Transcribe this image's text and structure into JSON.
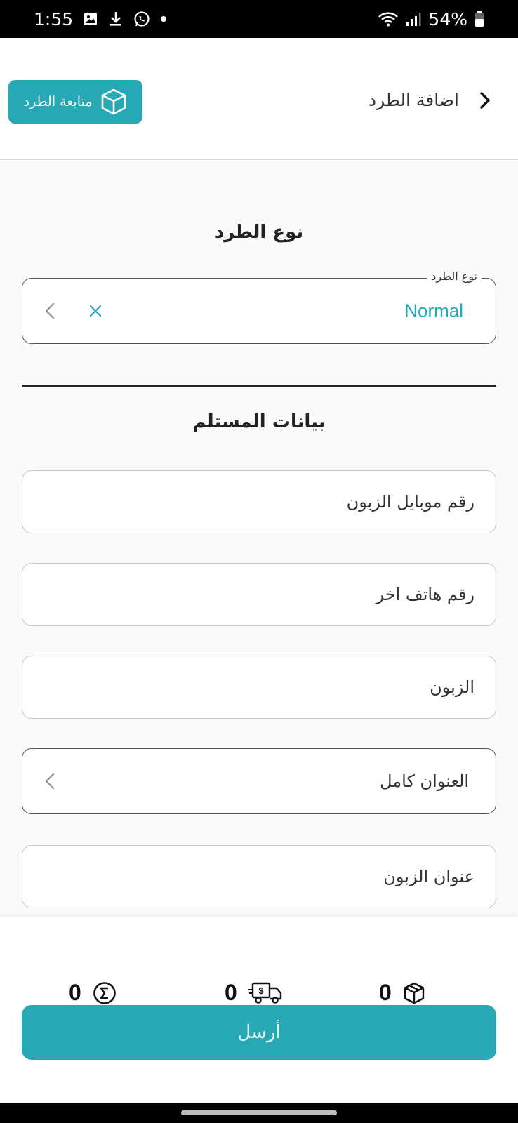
{
  "status_bar": {
    "time": "1:55",
    "battery": "54%",
    "icons": [
      "gallery-icon",
      "download-icon",
      "whatsapp-icon",
      "dot-icon",
      "wifi-icon",
      "signal-icon",
      "battery-icon"
    ]
  },
  "header": {
    "title": "اضافة الطرد",
    "track_button_label": "متابعة الطرد",
    "icons": [
      "chevron-right-icon",
      "box-icon"
    ]
  },
  "parcel_type_section": {
    "title": "نوع الطرد",
    "field_label": "نوع الطرد",
    "selected_value": "Normal"
  },
  "recipient_section": {
    "title": "بيانات المستلم",
    "fields": [
      {
        "placeholder": "رقم موبايل الزبون"
      },
      {
        "placeholder": "رقم هاتف اخر"
      },
      {
        "placeholder": "الزبون"
      },
      {
        "placeholder": "العنوان كامل"
      },
      {
        "placeholder": "عنوان الزبون"
      }
    ]
  },
  "summary": {
    "total": "0",
    "delivery": "0",
    "parcels": "0",
    "icons": [
      "sigma-icon",
      "delivery-truck-icon",
      "box-icon"
    ]
  },
  "send_button_label": "أرسل",
  "colors": {
    "accent": "#26a9b5",
    "background": "#fafafa",
    "border": "#c6c6c6"
  }
}
